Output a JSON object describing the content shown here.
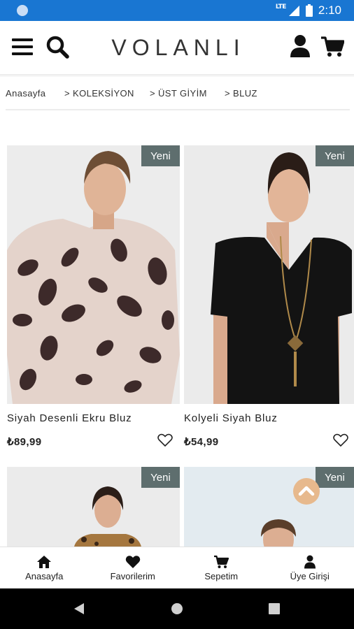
{
  "status_bar": {
    "network": "LTE",
    "time": "2:10"
  },
  "header": {
    "logo": "VOLANLI",
    "menu_icon": "hamburger-menu-icon",
    "search_icon": "search-icon",
    "user_icon": "user-icon",
    "cart_icon": "cart-icon"
  },
  "breadcrumb": [
    "Anasayfa",
    "> KOLEKSİYON",
    "> ÜST GİYİM",
    "> BLUZ"
  ],
  "products": [
    {
      "name": "Siyah Desenli Ekru Bluz",
      "price": "₺89,99",
      "badge": "Yeni"
    },
    {
      "name": "Kolyeli Siyah Bluz",
      "price": "₺54,99",
      "badge": "Yeni"
    },
    {
      "name": "",
      "price": "",
      "badge": "Yeni"
    },
    {
      "name": "",
      "price": "",
      "badge": "Yeni"
    }
  ],
  "bottom_nav": [
    {
      "label": "Anasayfa",
      "icon": "home-icon"
    },
    {
      "label": "Favorilerim",
      "icon": "heart-icon"
    },
    {
      "label": "Sepetim",
      "icon": "cart-icon"
    },
    {
      "label": "Üye Girişi",
      "icon": "user-icon"
    }
  ],
  "colors": {
    "status_bar": "#1976d2",
    "badge": "#5e6e6e",
    "scroll_top_button": "#e7b98d"
  }
}
